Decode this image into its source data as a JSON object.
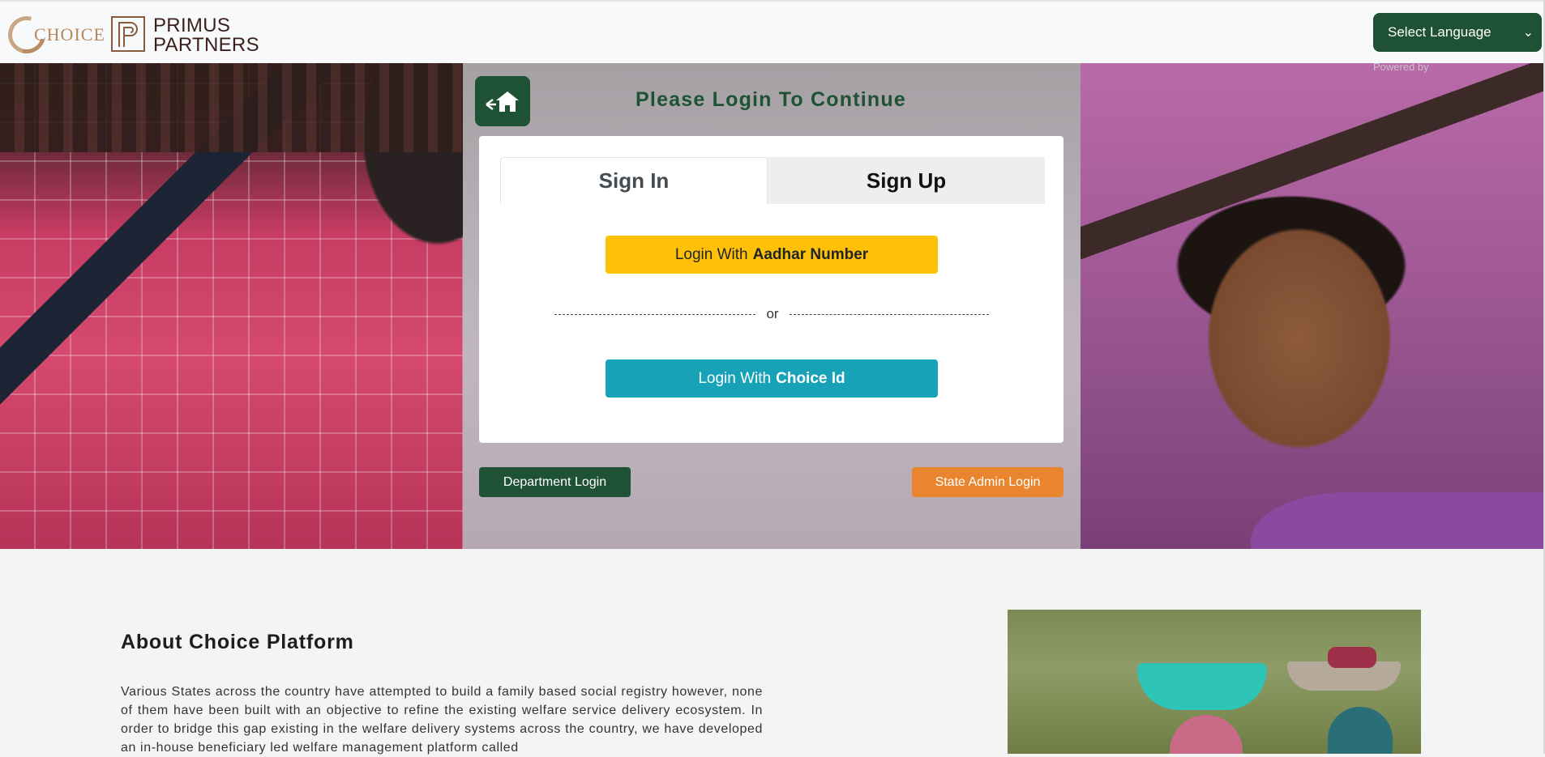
{
  "header": {
    "choice_logo_text": "CHOICE",
    "partner_logo_line1": "PRIMUS",
    "partner_logo_line2": "PARTNERS",
    "language_select": "Select Language",
    "powered_by": "Powered by"
  },
  "login": {
    "heading": "Please Login To Continue",
    "tabs": [
      {
        "label": "Sign In",
        "active": true
      },
      {
        "label": "Sign Up",
        "active": false
      }
    ],
    "aadhar_button": {
      "prefix": "Login With",
      "bold": "Aadhar Number"
    },
    "divider_text": "or",
    "choice_button": {
      "prefix": "Login With",
      "bold": "Choice Id"
    },
    "department_login": "Department Login",
    "state_admin_login": "State Admin Login"
  },
  "about": {
    "title": "About Choice Platform",
    "text": "Various States across the country have attempted to build a family based social registry however, none of them have been built with an objective to refine the existing welfare service delivery ecosystem. In order to bridge this gap existing in the welfare delivery systems across the country, we have developed an in-house beneficiary led welfare management platform called"
  },
  "colors": {
    "primary_green": "#1f5134",
    "aadhar_yellow": "#ffc107",
    "choice_teal": "#17a2b8",
    "state_orange": "#e8852e"
  }
}
